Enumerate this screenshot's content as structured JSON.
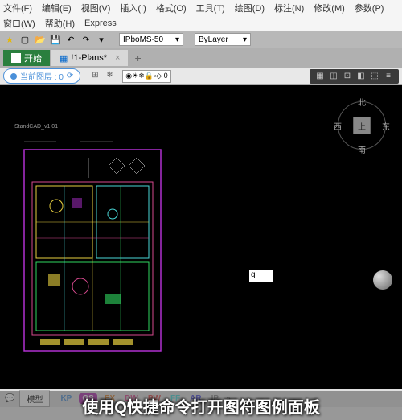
{
  "menu1": {
    "file": "文件(F)",
    "edit": "编辑(E)",
    "view": "视图(V)",
    "insert": "插入(I)",
    "format": "格式(O)",
    "tools": "工具(T)",
    "draw": "绘图(D)",
    "annotate": "标注(N)",
    "modify": "修改(M)",
    "params": "参数(P)"
  },
  "menu2": {
    "window": "窗口(W)",
    "help": "帮助(H)",
    "express": "Express"
  },
  "toolbar": {
    "dd1": "IPboMS-50",
    "dd2": "ByLayer"
  },
  "tabs": {
    "start": "开始",
    "file": "!1-Plans*",
    "close": "×",
    "plus": "+"
  },
  "layerbar": {
    "current": "当前图层 : 0",
    "pill2": "0",
    "dd": "◉☀❄🔒▫◇ 0"
  },
  "canvas": {
    "drawlabel": "StandCAD_v1.01",
    "cmd": "q"
  },
  "compass": {
    "n": "北",
    "s": "南",
    "e": "东",
    "w": "西",
    "top": "上"
  },
  "bottom": {
    "model": "模型",
    "tags": [
      {
        "t": "KP",
        "c": "#4a90d9"
      },
      {
        "t": "GS",
        "c": "#fff",
        "bg": "#b030b0"
      },
      {
        "t": "EX",
        "c": "#d98030"
      },
      {
        "t": "DW",
        "c": "#d94a90"
      },
      {
        "t": "PW",
        "c": "#d94a4a"
      },
      {
        "t": "FF",
        "c": "#4ad9d9"
      },
      {
        "t": "AR",
        "c": "#4a4ad9"
      },
      {
        "t": "IP",
        "c": "#888"
      }
    ],
    "chev": "»"
  },
  "caption": "使用Q快捷命令打开图符图例面板"
}
